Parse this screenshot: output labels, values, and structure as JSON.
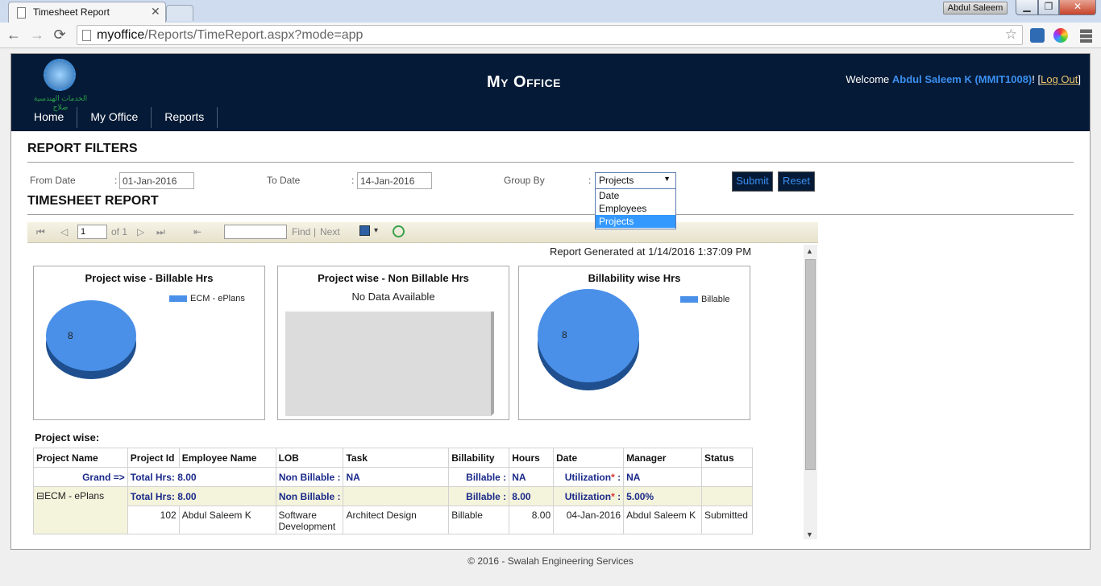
{
  "browser": {
    "tab_title": "Timesheet Report",
    "tab_close": "✕",
    "user_badge": "Abdul Saleem",
    "url_host": "myoffice",
    "url_path": "/Reports/TimeReport.aspx?mode=app",
    "win_min": "▁",
    "win_max": "❐",
    "win_close": "✕",
    "back": "←",
    "forward": "→",
    "reload": "⟳",
    "star": "☆"
  },
  "header": {
    "logo_text": "الخدمات الهندسية صلاح",
    "title": "My Office",
    "welcome_prefix": "Welcome ",
    "user": "Abdul Saleem K (MMIT1008)",
    "welcome_suffix": "! [",
    "logout": "Log Out",
    "logout_suffix": "]"
  },
  "menu": [
    "Home",
    "My Office",
    "Reports"
  ],
  "filters": {
    "section_title": "REPORT FILTERS",
    "from_label": "From Date",
    "from_value": "01-Jan-2016",
    "to_label": "To Date",
    "to_value": "14-Jan-2016",
    "group_label": "Group By",
    "group_value": "Projects",
    "group_options": [
      "Date",
      "Employees",
      "Projects"
    ],
    "colon": ":",
    "submit": "Submit",
    "reset": "Reset"
  },
  "report": {
    "section_title": "TIMESHEET REPORT",
    "toolbar": {
      "first": "⏮",
      "prev": "◁",
      "page": "1",
      "of": "of 1",
      "next": "▷",
      "last": "⏭",
      "back": "⇤",
      "find": "Find",
      "sep": "|",
      "find_next": "Next",
      "export_arrow": "▾"
    },
    "generated": "Report Generated at 1/14/2016 1:37:09 PM",
    "scroll_up": "▲",
    "scroll_down": "▼"
  },
  "chart_data": [
    {
      "type": "pie",
      "title": "Project wise - Billable Hrs",
      "labels": [
        "ECM - ePlans"
      ],
      "values": [
        8
      ],
      "colors": [
        "#4a90e8"
      ]
    },
    {
      "type": "pie",
      "title": "Project wise - Non Billable Hrs",
      "labels": [],
      "values": [],
      "annotation": "No Data Available"
    },
    {
      "type": "pie",
      "title": "Billability wise Hrs",
      "labels": [
        "Billable"
      ],
      "values": [
        8
      ],
      "colors": [
        "#4a90e8"
      ]
    }
  ],
  "table": {
    "label": "Project wise:",
    "headers": [
      "Project Name",
      "Project Id",
      "Employee Name",
      "LOB",
      "Task",
      "Billability",
      "Hours",
      "Date",
      "Manager",
      "Status"
    ],
    "grand": {
      "label": "Grand =>",
      "total_hrs_label": "Total Hrs:",
      "total_hrs": "8.00",
      "nonbill_label": "Non Billable :",
      "nonbill": "NA",
      "bill_label": "Billable :",
      "bill": "NA",
      "util_label": "Utilization",
      "util_star": "*",
      "util_colon": " :",
      "util": "NA"
    },
    "group": {
      "expander": "⊟",
      "name": "ECM - ePlans",
      "total_hrs_label": "Total Hrs:",
      "total_hrs": "8.00",
      "nonbill_label": "Non Billable :",
      "nonbill": "",
      "bill_label": "Billable :",
      "bill": "8.00",
      "util_label": "Utilization",
      "util_star": "*",
      "util_colon": " :",
      "util": "5.00%"
    },
    "rows": [
      {
        "project_id": "102",
        "employee": "Abdul Saleem  K",
        "lob": "Software Development",
        "task": "Architect Design",
        "billability": "Billable",
        "hours": "8.00",
        "date": "04-Jan-2016",
        "manager": "Abdul Saleem  K",
        "status": "Submitted"
      }
    ]
  },
  "footer": "© 2016 - Swalah Engineering Services"
}
